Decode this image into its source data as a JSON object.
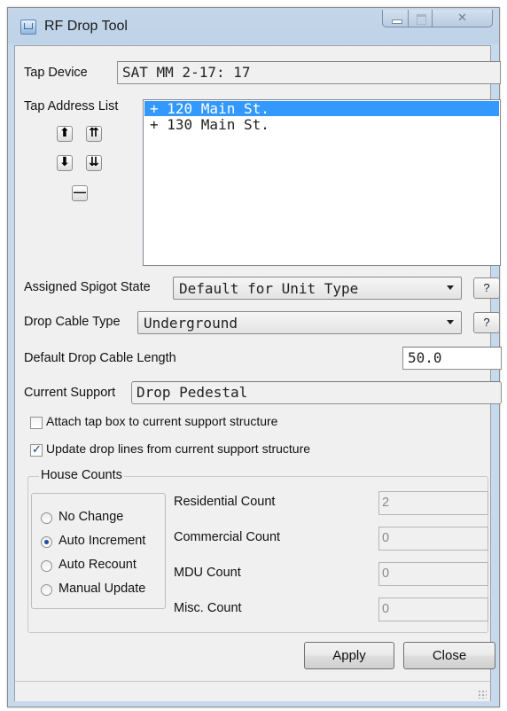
{
  "window": {
    "title": "RF Drop Tool",
    "controls": {
      "minimize": "",
      "maximize": "",
      "close": "✕"
    }
  },
  "tap_device": {
    "label": "Tap Device",
    "value": "SAT MM 2-17: 17"
  },
  "tap_address_list": {
    "label": "Tap Address List",
    "items": [
      "+ 120 Main St.",
      "+ 130 Main St."
    ],
    "selected_index": 0,
    "buttons": {
      "move_up": "⬆",
      "move_top": "⇈",
      "move_down": "⬇",
      "move_bottom": "⇊",
      "remove": "—"
    }
  },
  "assigned_spigot_state": {
    "label": "Assigned Spigot State",
    "value": "Default for Unit Type",
    "help": "?"
  },
  "drop_cable_type": {
    "label": "Drop Cable Type",
    "value": "Underground",
    "help": "?"
  },
  "default_drop_cable_length": {
    "label": "Default Drop Cable Length",
    "value": "50.0"
  },
  "current_support": {
    "label": "Current Support",
    "value": "Drop Pedestal"
  },
  "checkboxes": {
    "attach_tap_box": {
      "label": "Attach tap box to current support structure",
      "checked": false
    },
    "update_drop_lines": {
      "label": "Update drop lines from current support structure",
      "checked": true
    }
  },
  "house_counts": {
    "title": "House Counts",
    "modes": [
      "No Change",
      "Auto Increment",
      "Auto Recount",
      "Manual Update"
    ],
    "selected_mode": "Auto Increment",
    "counts": [
      {
        "label": "Residential Count",
        "value": "2"
      },
      {
        "label": "Commercial Count",
        "value": "0"
      },
      {
        "label": "MDU Count",
        "value": "0"
      },
      {
        "label": "Misc. Count",
        "value": "0"
      }
    ]
  },
  "actions": {
    "apply": "Apply",
    "close": "Close"
  },
  "colors": {
    "selection": "#3399ff",
    "title_bar": "#bfd3e8",
    "dialog_bg": "#f0f0f0"
  }
}
